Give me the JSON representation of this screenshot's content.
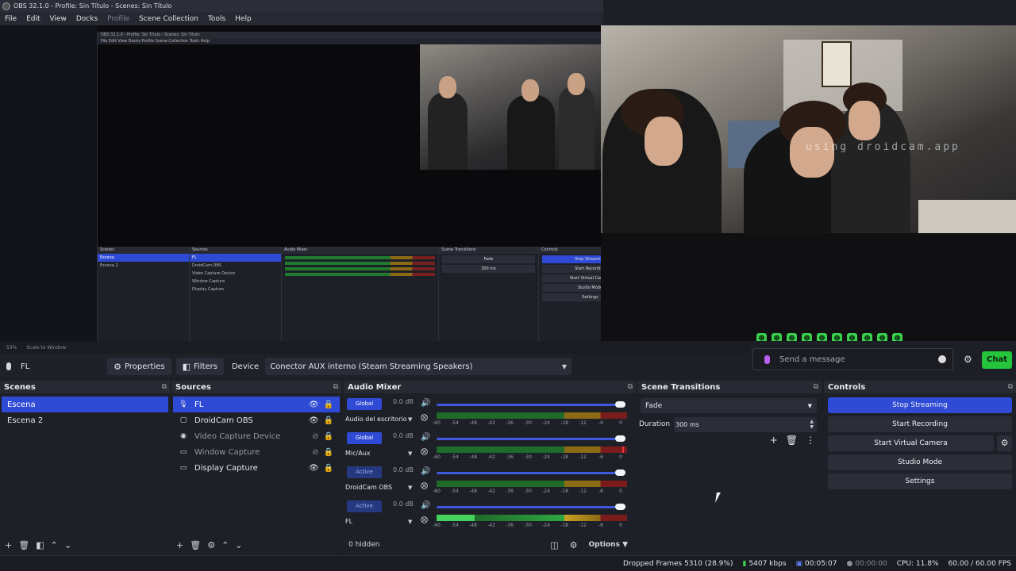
{
  "window": {
    "title": "OBS 32.1.0 - Profile: Sin Título - Scenes: Sin Título"
  },
  "menu": [
    "File",
    "Edit",
    "View",
    "Docks",
    "Profile",
    "Scene Collection",
    "Tools",
    "Help"
  ],
  "nested": {
    "title": "OBS 32.1.0 - Profile: Sin Título - Scenes: Sin Título",
    "menu": "File  Edit  View  Docks  Profile  Scene Collection  Tools  Help",
    "scenes_head": "Scenes",
    "sources_head": "Sources",
    "mixer_head": "Audio Mixer",
    "transitions_head": "Scene Transitions",
    "controls_head": "Controls",
    "stop_streaming": "Stop Streaming",
    "start_recording": "Start Recording"
  },
  "preview": {
    "watermark": "using droidcam.app",
    "zoom": "53%",
    "scale_mode": "Scale to Window"
  },
  "chat": {
    "placeholder": "Send a message",
    "button": "Chat",
    "emotes": [
      "☻",
      "☻",
      "☻",
      "☻",
      "☻",
      "☻",
      "☻",
      "☻",
      "☻",
      "☻"
    ]
  },
  "context": {
    "source_name": "FL",
    "properties": "Properties",
    "filters": "Filters",
    "device_label": "Device",
    "device_value": "Conector AUX interno (Steam Streaming Speakers)"
  },
  "scenes": {
    "title": "Scenes",
    "items": [
      "Escena",
      "Escena 2"
    ]
  },
  "sources": {
    "title": "Sources",
    "items": [
      {
        "name": "FL",
        "icon": "mic-icon",
        "glyph": "🎙"
      },
      {
        "name": "DroidCam OBS",
        "icon": "droidcam-icon",
        "glyph": "▢"
      },
      {
        "name": "Video Capture Device",
        "icon": "camera-icon",
        "glyph": "◉"
      },
      {
        "name": "Window Capture",
        "icon": "window-icon",
        "glyph": "▭"
      },
      {
        "name": "Display Capture",
        "icon": "monitor-icon",
        "glyph": "▭"
      }
    ]
  },
  "mixer": {
    "title": "Audio Mixer",
    "channels": [
      {
        "badge": "Global",
        "db": "0.0 dB",
        "name": "Audio del escritorio"
      },
      {
        "badge": "Global",
        "db": "0.0 dB",
        "name": "Mic/Aux"
      },
      {
        "badge": "Active",
        "db": "0.0 dB",
        "name": "DroidCam OBS"
      },
      {
        "badge": "Active",
        "db": "0.0 dB",
        "name": "FL"
      }
    ],
    "ticks": [
      "-60",
      "-54",
      "-48",
      "-42",
      "-36",
      "-30",
      "-24",
      "-18",
      "-12",
      "-6",
      "0"
    ],
    "hidden": "0 hidden",
    "options": "Options"
  },
  "transitions": {
    "title": "Scene Transitions",
    "type": "Fade",
    "duration_label": "Duration",
    "duration_value": "300 ms"
  },
  "controls": {
    "title": "Controls",
    "stop_streaming": "Stop Streaming",
    "start_recording": "Start Recording",
    "start_virtual_camera": "Start Virtual Camera",
    "studio_mode": "Studio Mode",
    "settings": "Settings"
  },
  "status": {
    "dropped_frames": "Dropped Frames 5310 (28.9%)",
    "bitrate": "5407 kbps",
    "stream_time": "00:05:07",
    "record_time": "00:00:00",
    "cpu": "CPU: 11.8%",
    "fps": "60.00 / 60.00 FPS"
  },
  "colors": {
    "accent": "#2f4bd6",
    "chat_button": "#25c43d",
    "background": "#1d1f26"
  }
}
